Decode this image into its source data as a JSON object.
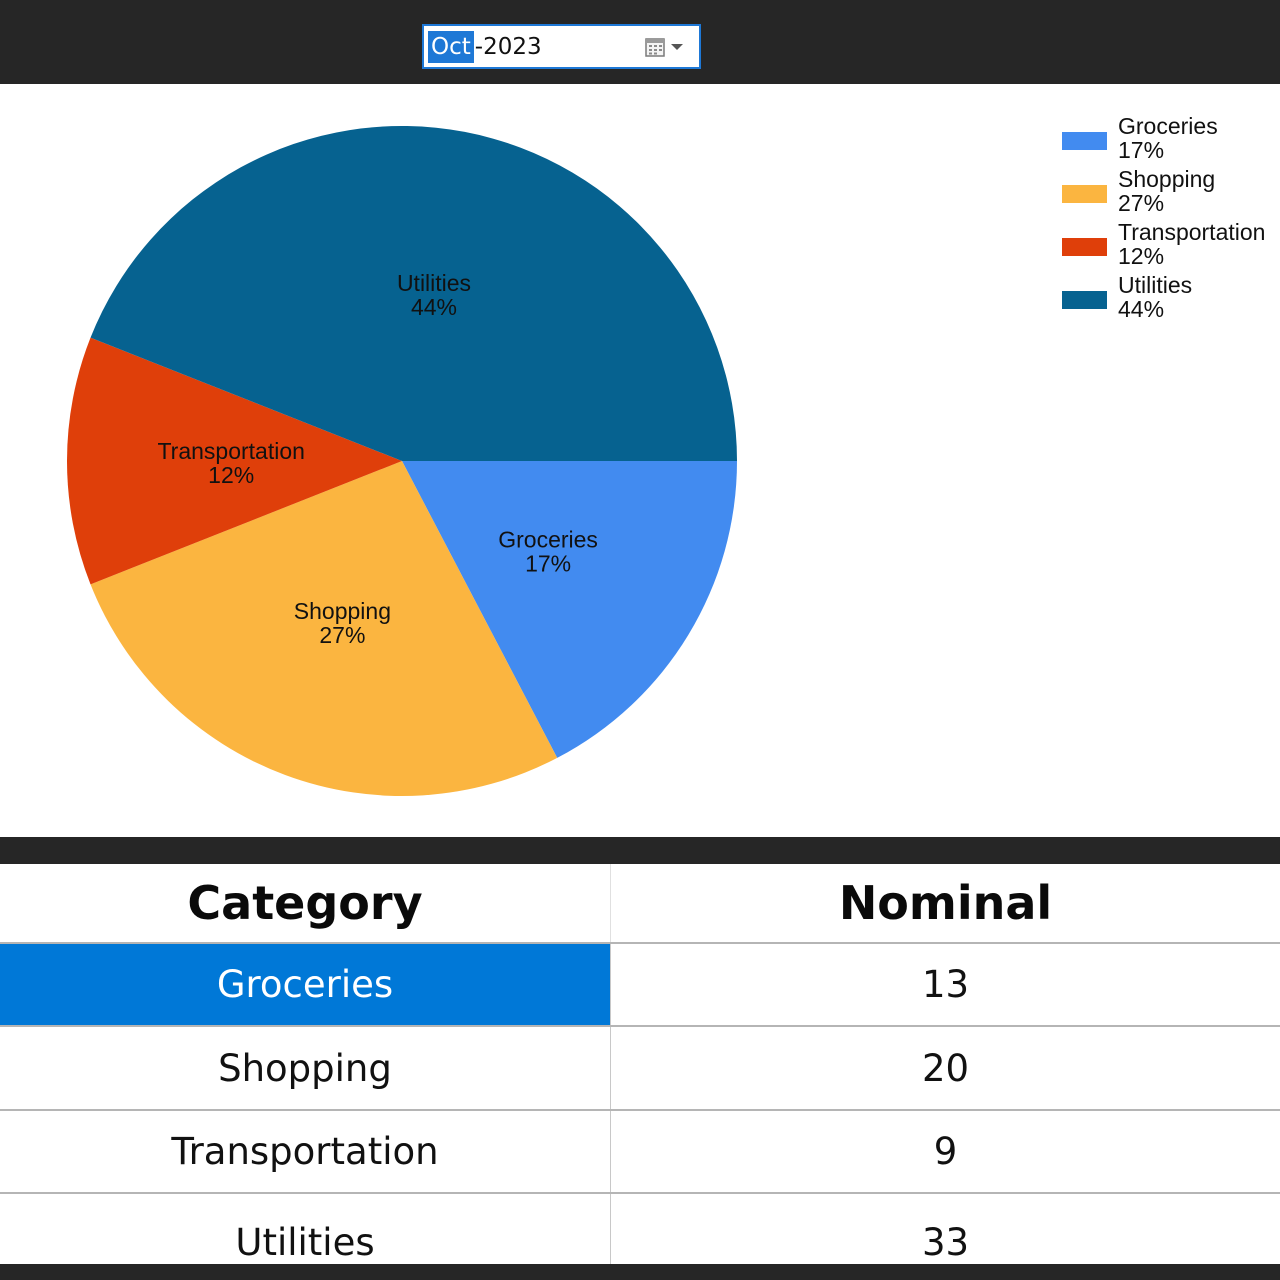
{
  "date_picker": {
    "month": "Oct",
    "rest": "-2023",
    "icons": [
      "calendar-icon",
      "chevron-down-icon"
    ]
  },
  "chart_data": {
    "type": "pie",
    "categories": [
      "Groceries",
      "Shopping",
      "Transportation",
      "Utilities"
    ],
    "values": [
      13,
      20,
      9,
      33
    ],
    "percent_labels": [
      "17%",
      "27%",
      "12%",
      "44%"
    ],
    "colors": [
      "#428bf0",
      "#fbb540",
      "#df3f0a",
      "#066290"
    ],
    "legend_position": "top-right",
    "title": "",
    "start_angle_deg": 0
  },
  "table": {
    "headers": [
      "Category",
      "Nominal"
    ],
    "rows": [
      {
        "category": "Groceries",
        "nominal": "13"
      },
      {
        "category": "Shopping",
        "nominal": "20"
      },
      {
        "category": "Transportation",
        "nominal": "9"
      },
      {
        "category": "Utilities",
        "nominal": "33"
      }
    ],
    "selected_index": 0,
    "selection_color": "#0078d7"
  }
}
